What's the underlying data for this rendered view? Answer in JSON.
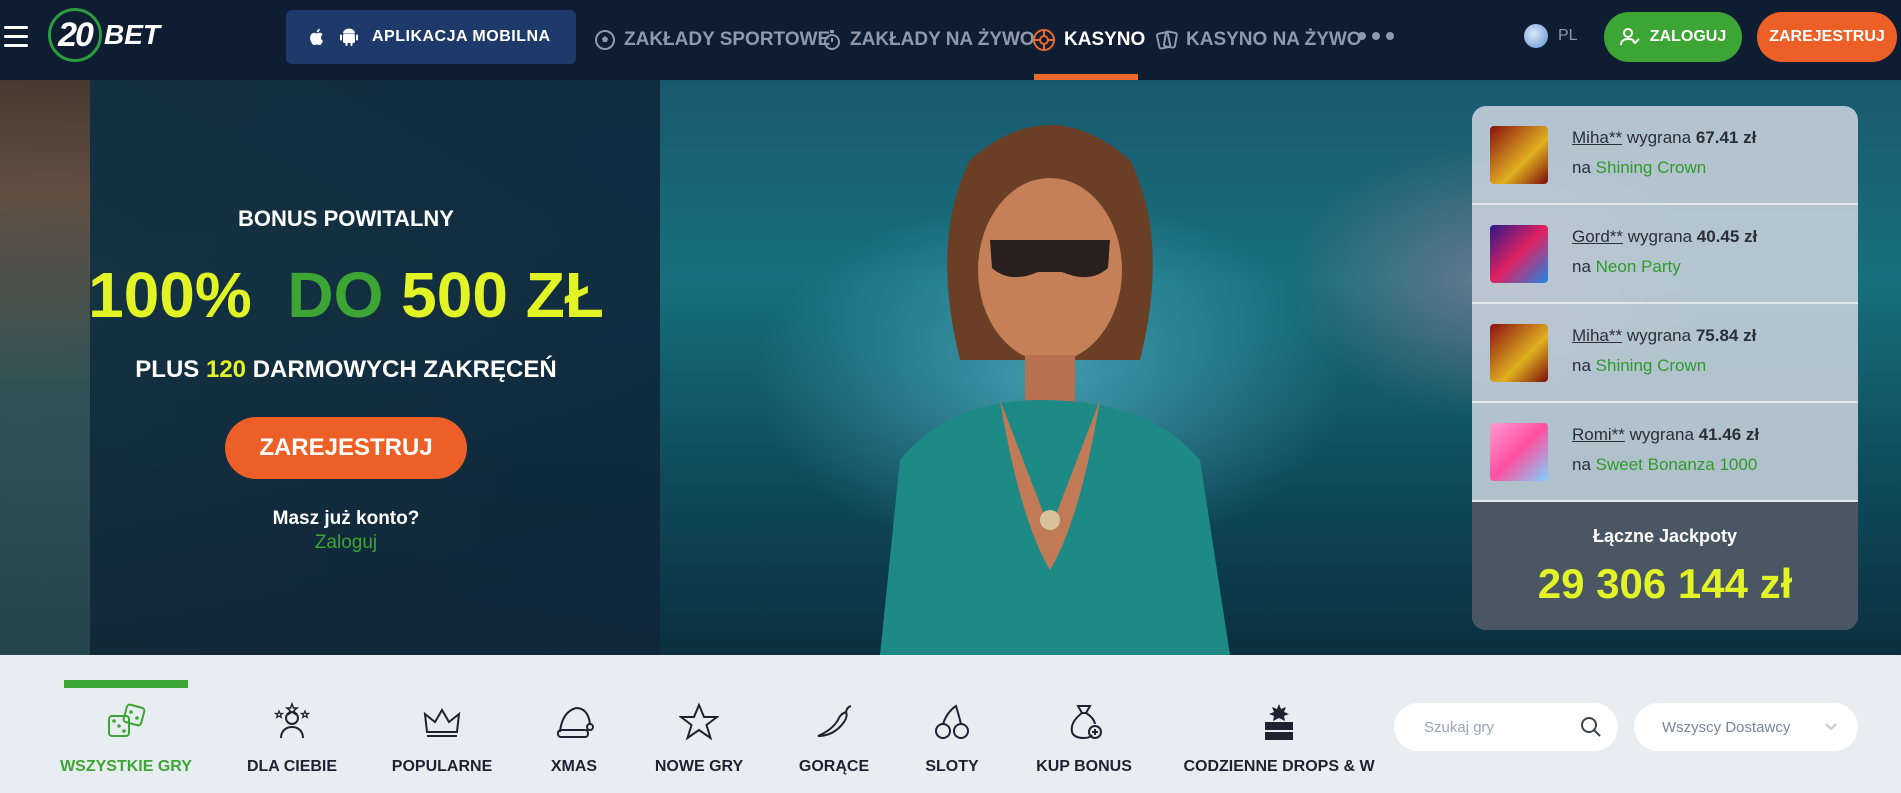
{
  "header": {
    "logo_number": "20",
    "logo_text": "BET",
    "app_button_label": "APLIKACJA MOBILNA",
    "nav": [
      {
        "label": "ZAKŁADY SPORTOWE",
        "active": false
      },
      {
        "label": "ZAKŁADY NA ŻYWO",
        "active": false
      },
      {
        "label": "KASYNO",
        "active": true
      },
      {
        "label": "KASYNO NA ŻYWO",
        "active": false
      }
    ],
    "language": "PL",
    "login_label": "ZALOGUJ",
    "register_label": "ZAREJESTRUJ"
  },
  "hero": {
    "bonus_title": "BONUS POWITALNY",
    "bonus_percent": "100%",
    "bonus_do": "DO",
    "bonus_amount": "500 ZŁ",
    "plus_prefix": "PLUS",
    "plus_number": "120",
    "plus_suffix": "DARMOWYCH ZAKRĘCEŃ",
    "register_label": "ZAREJESTRUJ",
    "have_account": "Masz już konto?",
    "login_link": "Zaloguj"
  },
  "winners": [
    {
      "user": "Miha**",
      "won_word": "wygrana",
      "amount": "67.41 zł",
      "on_word": "na",
      "game": "Shining Crown"
    },
    {
      "user": "Gord**",
      "won_word": "wygrana",
      "amount": "40.45 zł",
      "on_word": "na",
      "game": "Neon Party"
    },
    {
      "user": "Miha**",
      "won_word": "wygrana",
      "amount": "75.84 zł",
      "on_word": "na",
      "game": "Shining Crown"
    },
    {
      "user": "Romi**",
      "won_word": "wygrana",
      "amount": "41.46 zł",
      "on_word": "na",
      "game": "Sweet Bonanza 1000"
    }
  ],
  "jackpot": {
    "label": "Łączne Jackpoty",
    "value": "29 306 144 zł"
  },
  "categories": [
    {
      "label": "WSZYSTKIE GRY",
      "icon": "dice-icon",
      "active": true
    },
    {
      "label": "DLA CIEBIE",
      "icon": "person-stars-icon",
      "active": false
    },
    {
      "label": "POPULARNE",
      "icon": "crown-icon",
      "active": false
    },
    {
      "label": "XMAS",
      "icon": "santa-hat-icon",
      "active": false
    },
    {
      "label": "NOWE GRY",
      "icon": "star-icon",
      "active": false
    },
    {
      "label": "GORĄCE",
      "icon": "chili-icon",
      "active": false
    },
    {
      "label": "SLOTY",
      "icon": "cherries-icon",
      "active": false
    },
    {
      "label": "KUP BONUS",
      "icon": "money-bag-icon",
      "active": false
    },
    {
      "label": "CODZIENNE DROPS & W",
      "icon": "drops-wins-icon",
      "active": false
    }
  ],
  "search": {
    "placeholder": "Szukaj gry"
  },
  "providers": {
    "selected": "Wszyscy Dostawcy"
  },
  "colors": {
    "header_bg": "#0f1d33",
    "accent_green": "#3da534",
    "accent_orange": "#ec5f26",
    "accent_yellow": "#e3f426"
  }
}
